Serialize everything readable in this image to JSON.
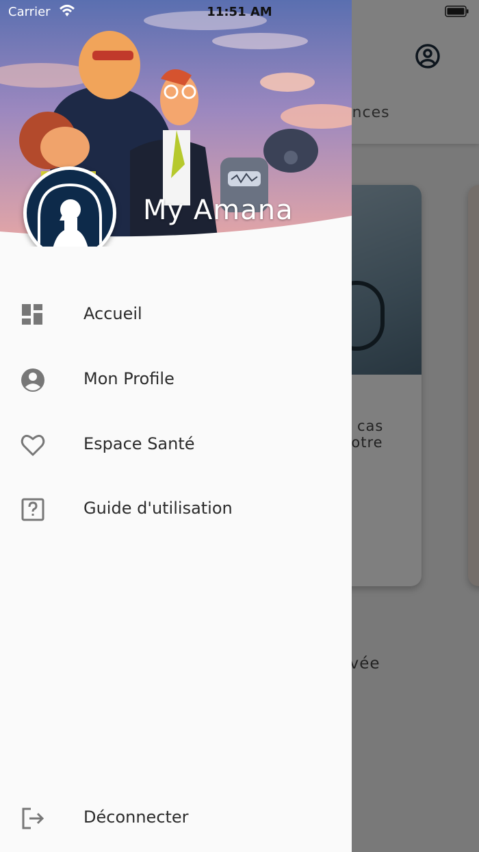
{
  "status_bar": {
    "carrier": "Carrier",
    "time": "11:51 AM"
  },
  "background_app": {
    "tab_fragment": "ences",
    "card_text_line1": "n cas",
    "card_text_line2": "votre",
    "bottom_text": "ouvée"
  },
  "drawer": {
    "brand_title": "My Amana",
    "menu": [
      {
        "label": "Accueil",
        "icon": "dashboard-icon"
      },
      {
        "label": "Mon Profile",
        "icon": "account-circle-icon"
      },
      {
        "label": "Espace Santé",
        "icon": "heart-outline-icon"
      },
      {
        "label": "Guide d'utilisation",
        "icon": "help-box-icon"
      }
    ],
    "logout": {
      "label": "Déconnecter",
      "icon": "logout-icon"
    }
  },
  "colors": {
    "brand_navy": "#0d2a4a",
    "icon_gray": "#777777"
  }
}
